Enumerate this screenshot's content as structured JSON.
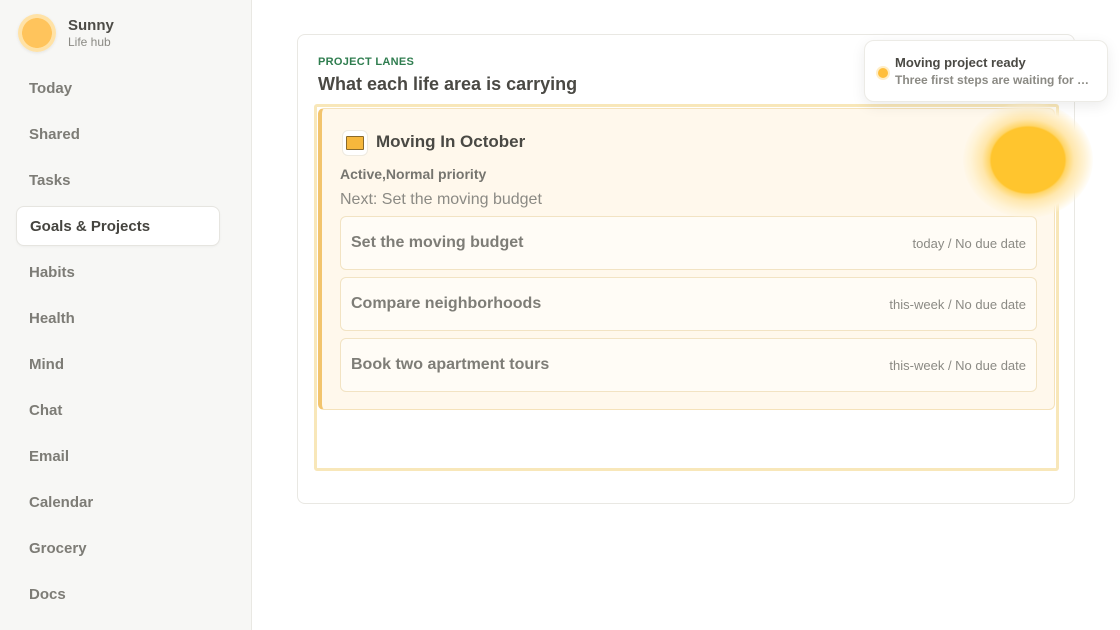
{
  "brand": {
    "name": "Sunny",
    "subtitle": "Life hub"
  },
  "nav": {
    "items": [
      {
        "label": "Today",
        "active": false
      },
      {
        "label": "Shared",
        "active": false
      },
      {
        "label": "Tasks",
        "active": false
      },
      {
        "label": "Goals & Projects",
        "active": true
      },
      {
        "label": "Habits",
        "active": false
      },
      {
        "label": "Health",
        "active": false
      },
      {
        "label": "Mind",
        "active": false
      },
      {
        "label": "Chat",
        "active": false
      },
      {
        "label": "Email",
        "active": false
      },
      {
        "label": "Calendar",
        "active": false
      },
      {
        "label": "Grocery",
        "active": false
      },
      {
        "label": "Docs",
        "active": false
      }
    ]
  },
  "panel": {
    "eyebrow": "PROJECT LANES",
    "title": "What each life area is carrying"
  },
  "lane": {
    "icon": "folder-icon",
    "title": "Moving In October",
    "meta": "Active,Normal priority",
    "next": "Next: Set the moving budget",
    "tasks": [
      {
        "name": "Set the moving budget",
        "when": "today / No due date"
      },
      {
        "name": "Compare neighborhoods",
        "when": "this-week / No due date"
      },
      {
        "name": "Book two apartment tours",
        "when": "this-week / No due date"
      }
    ]
  },
  "toast": {
    "title": "Moving project ready",
    "body": "Three first steps are waiting for you."
  },
  "colors": {
    "accent": "#f6b73c",
    "eyebrow": "#2f7d4f",
    "lane_bg": "#fff8ec"
  }
}
